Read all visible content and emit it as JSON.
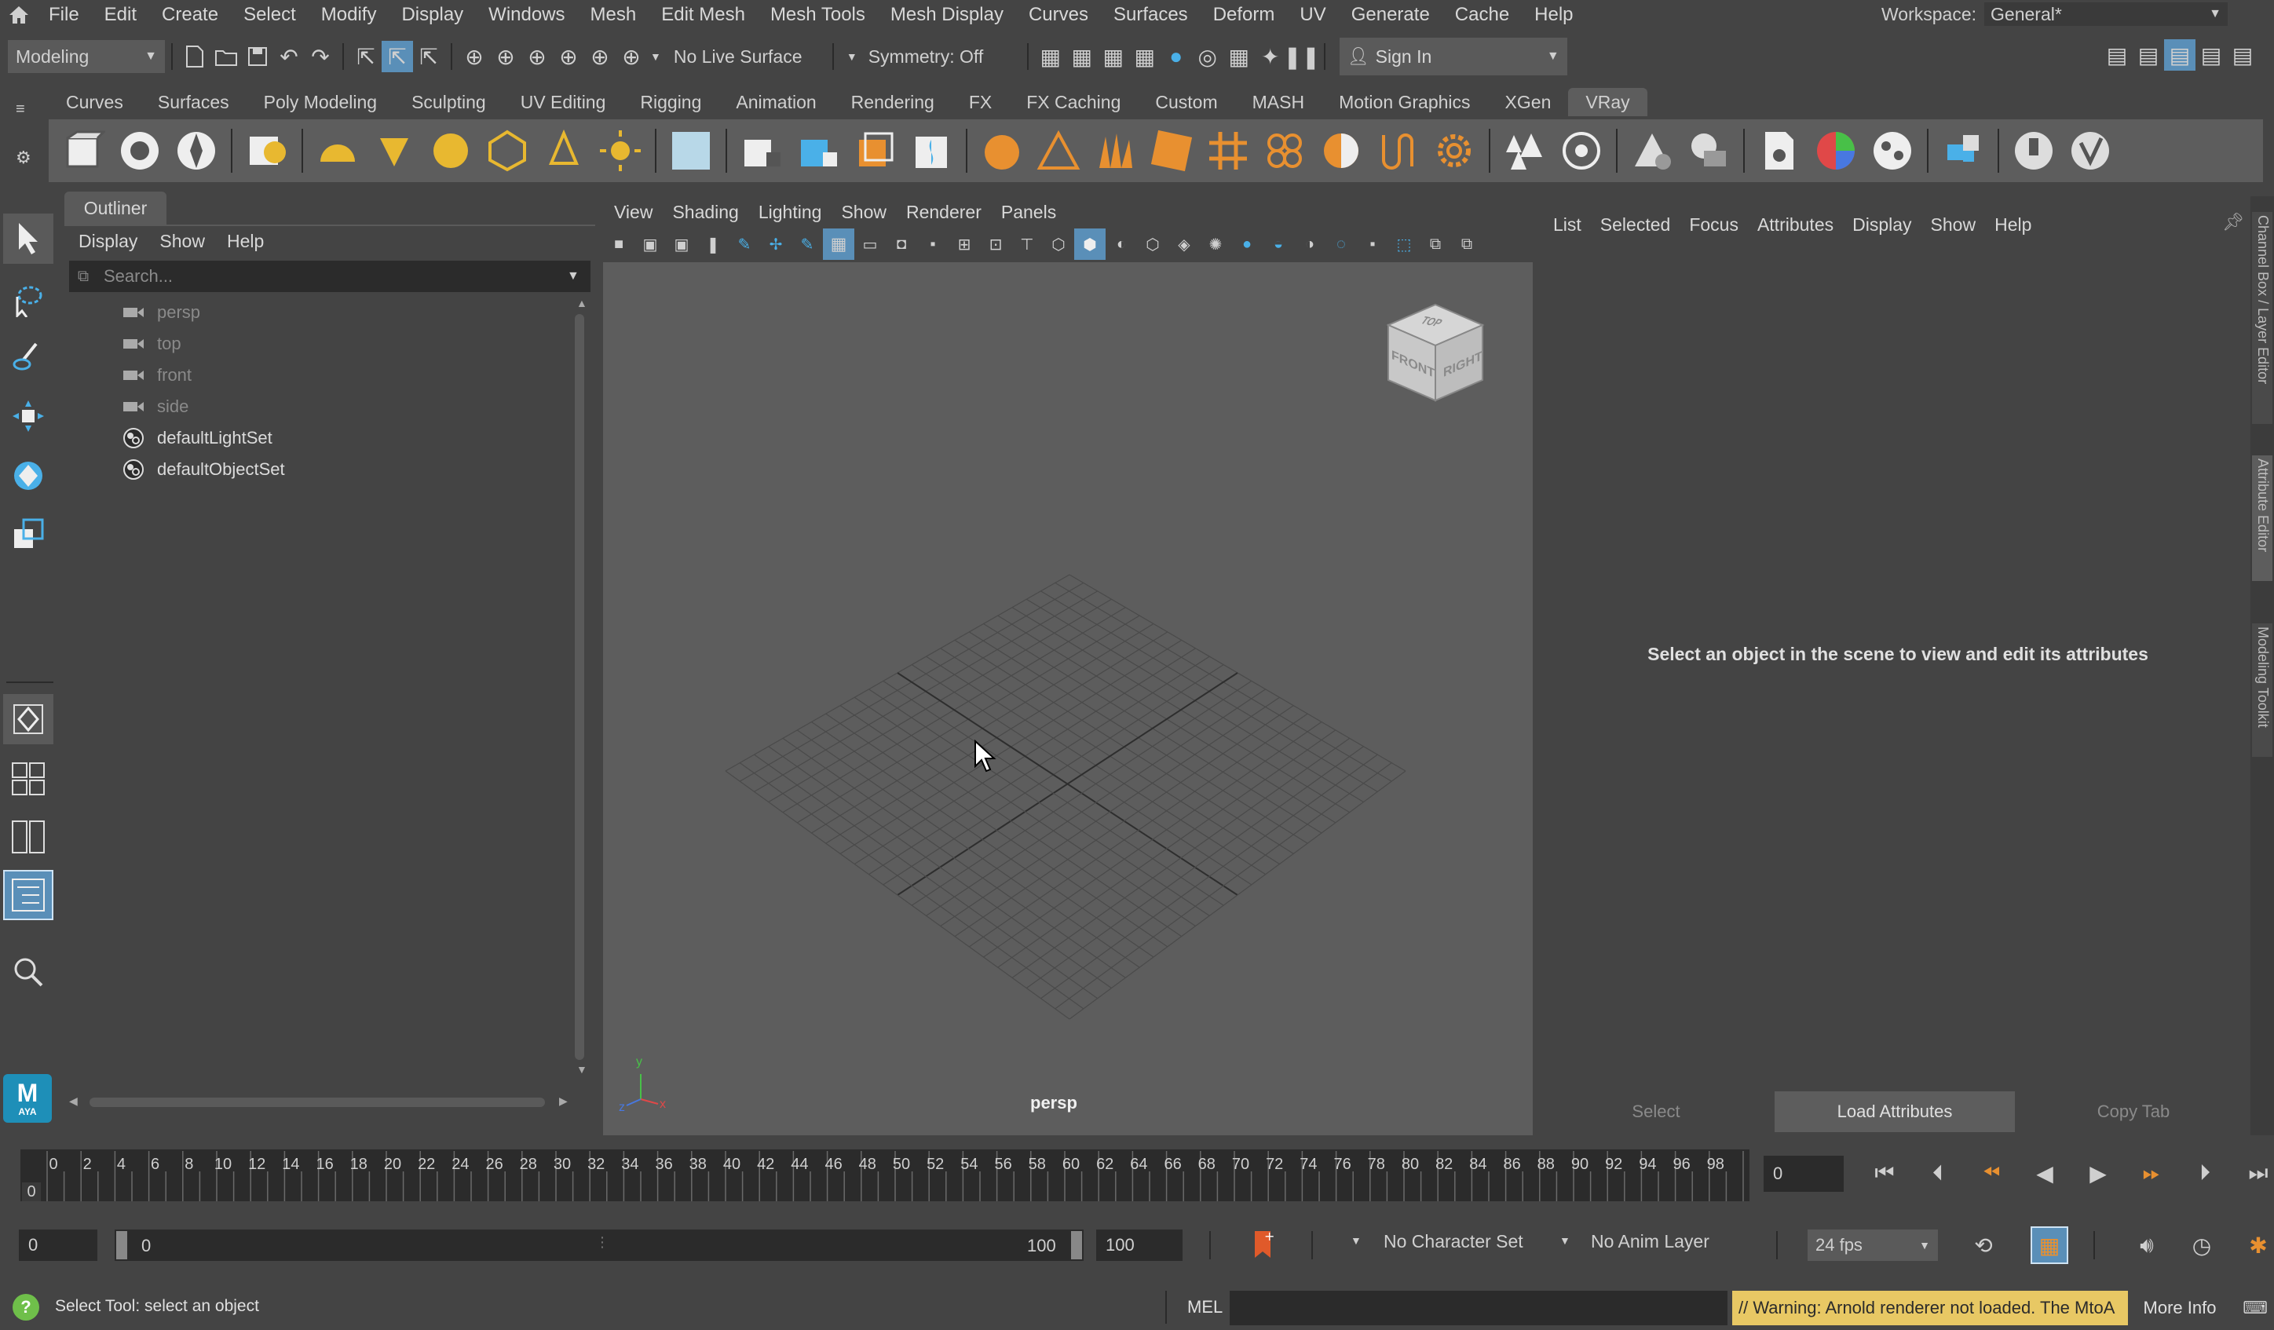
{
  "menubar": {
    "items": [
      "File",
      "Edit",
      "Create",
      "Select",
      "Modify",
      "Display",
      "Windows",
      "Mesh",
      "Edit Mesh",
      "Mesh Tools",
      "Mesh Display",
      "Curves",
      "Surfaces",
      "Deform",
      "UV",
      "Generate",
      "Cache",
      "Help"
    ],
    "workspace_label": "Workspace:",
    "workspace_value": "General*"
  },
  "statusline": {
    "mode": "Modeling",
    "live_surface": "No Live Surface",
    "symmetry": "Symmetry: Off",
    "sign_in": "Sign In"
  },
  "shelf": {
    "tabs": [
      "Curves",
      "Surfaces",
      "Poly Modeling",
      "Sculpting",
      "UV Editing",
      "Rigging",
      "Animation",
      "Rendering",
      "FX",
      "FX Caching",
      "Custom",
      "MASH",
      "Motion Graphics",
      "XGen",
      "VRay"
    ],
    "active_tab": "VRay"
  },
  "outliner": {
    "title": "Outliner",
    "menu": [
      "Display",
      "Show",
      "Help"
    ],
    "search_placeholder": "Search...",
    "items": [
      {
        "label": "persp",
        "icon": "camera-icon",
        "dim": true
      },
      {
        "label": "top",
        "icon": "camera-icon",
        "dim": true
      },
      {
        "label": "front",
        "icon": "camera-icon",
        "dim": true
      },
      {
        "label": "side",
        "icon": "camera-icon",
        "dim": true
      },
      {
        "label": "defaultLightSet",
        "icon": "set-icon",
        "dim": false
      },
      {
        "label": "defaultObjectSet",
        "icon": "set-icon",
        "dim": false
      }
    ]
  },
  "viewport": {
    "menu": [
      "View",
      "Shading",
      "Lighting",
      "Show",
      "Renderer",
      "Panels"
    ],
    "camera_label": "persp",
    "viewcube": {
      "front": "FRONT",
      "right": "RIGHT",
      "top": "TOP"
    },
    "axis": {
      "x": "x",
      "y": "y",
      "z": "z"
    }
  },
  "attribute_editor": {
    "menu": [
      "List",
      "Selected",
      "Focus",
      "Attributes",
      "Display",
      "Show",
      "Help"
    ],
    "message": "Select an object in the scene to view and edit its attributes",
    "buttons": {
      "select": "Select",
      "load": "Load Attributes",
      "copy": "Copy Tab"
    },
    "side_tabs": [
      "Channel Box / Layer Editor",
      "Attribute Editor",
      "Modeling Toolkit"
    ]
  },
  "timeline": {
    "ticks": [
      "0",
      "2",
      "4",
      "6",
      "8",
      "10",
      "12",
      "14",
      "16",
      "18",
      "20",
      "22",
      "24",
      "26",
      "28",
      "30",
      "32",
      "34",
      "36",
      "38",
      "40",
      "42",
      "44",
      "46",
      "48",
      "50",
      "52",
      "54",
      "56",
      "58",
      "60",
      "62",
      "64",
      "66",
      "68",
      "70",
      "72",
      "74",
      "76",
      "78",
      "80",
      "82",
      "84",
      "86",
      "88",
      "90",
      "92",
      "94",
      "96",
      "98",
      "10"
    ],
    "current_marker": "0",
    "current_frame": "0"
  },
  "range": {
    "start": "0",
    "slider_start": "0",
    "slider_end": "100",
    "end": "100",
    "character_set": "No Character Set",
    "anim_layer": "No Anim Layer",
    "fps": "24 fps"
  },
  "helpline": {
    "message": "Select Tool: select an object",
    "mel_label": "MEL",
    "warning": "// Warning: Arnold renderer not loaded. The MtoA",
    "more_info": "More Info"
  },
  "colors": {
    "accent": "#5a9fd4",
    "warning_bg": "#e8c864",
    "shelf_yellow": "#e8b830",
    "shelf_orange": "#e89030",
    "shelf_blue": "#4ab0e8"
  }
}
